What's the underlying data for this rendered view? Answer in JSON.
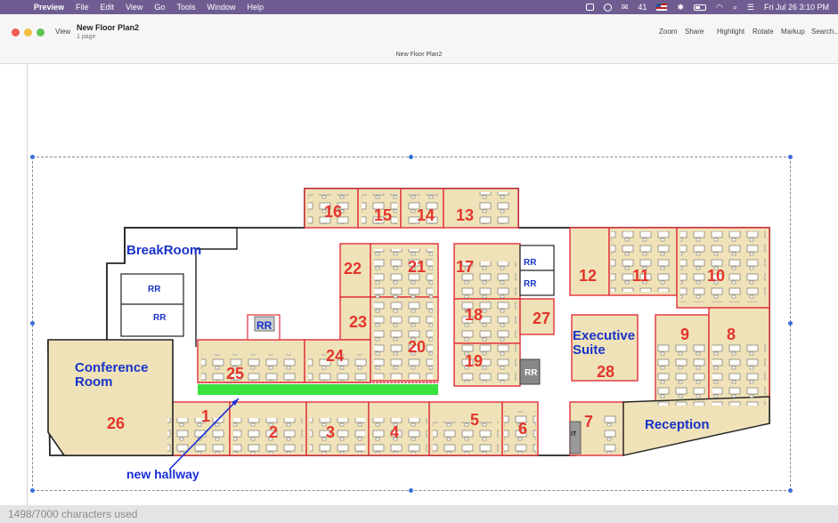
{
  "menubar": {
    "app_name": "Preview",
    "menus": [
      "File",
      "Edit",
      "View",
      "Go",
      "Tools",
      "Window",
      "Help"
    ],
    "chat_count": "41",
    "datetime": "Fri Jul 26  3:10 PM"
  },
  "window": {
    "view_label": "View",
    "title": "New Floor Plan2",
    "subtitle": "1 page",
    "tab_title": "New Floor Plan2",
    "toolbar": {
      "zoom": "Zoom",
      "share": "Share",
      "highlight": "Highlight",
      "rotate": "Rotate",
      "markup": "Markup",
      "search": "Search..."
    }
  },
  "floorplan": {
    "rooms": {
      "r1": "1",
      "r2": "2",
      "r3": "3",
      "r4": "4",
      "r5": "5",
      "r6": "6",
      "r7": "7",
      "r8": "8",
      "r9": "9",
      "r10": "10",
      "r11": "11",
      "r12": "12",
      "r13": "13",
      "r14": "14",
      "r15": "15",
      "r16": "16",
      "r17": "17",
      "r18": "18",
      "r19": "19",
      "r20": "20",
      "r21": "21",
      "r22": "22",
      "r23": "23",
      "r24": "24",
      "r25": "25",
      "r26": "26",
      "r27": "27",
      "r28": "28"
    },
    "labels": {
      "breakroom": "BreakRoom",
      "conference_1": "Conference",
      "conference_2": "Room",
      "executive_1": "Executive",
      "executive_2": "Suite",
      "reception": "Reception",
      "rr": "RR",
      "it": "IT",
      "annotation": "new hallway"
    },
    "colors": {
      "room_fill": "#efe2b8",
      "room_wall": "#e0303a",
      "room_number": "#e4352c",
      "room_name": "#1833c8",
      "rr_fill": "#cccccc",
      "hallway": "#39e23e",
      "annotation": "#1a2ed8"
    }
  },
  "status": {
    "char_count": "1498/7000 characters used"
  }
}
